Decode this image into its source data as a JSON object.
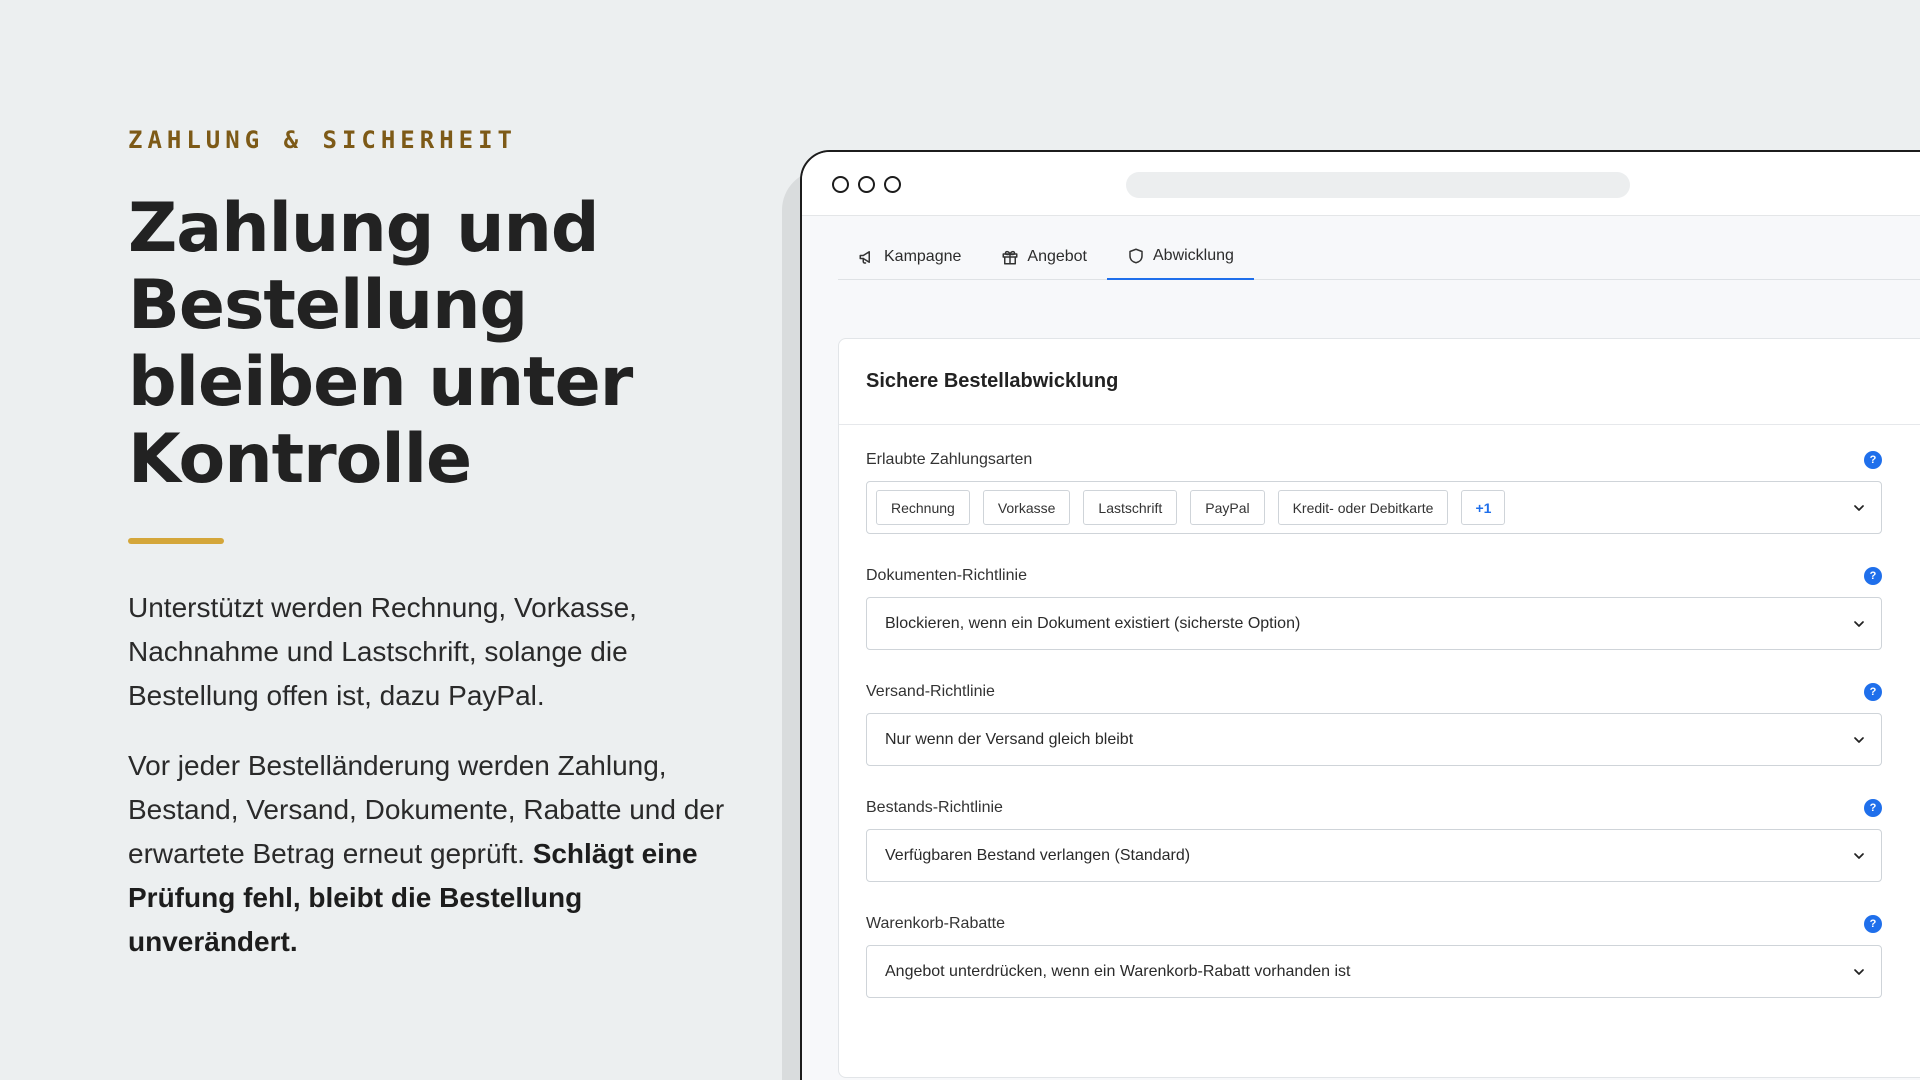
{
  "hero": {
    "eyebrow": "ZAHLUNG & SICHERHEIT",
    "headline": "Zahlung und Bestellung bleiben unter Kontrolle",
    "paragraph1": "Unterstützt werden Rechnung, Vorkasse, Nachnahme und Lastschrift, solange die Bestellung offen ist, dazu PayPal.",
    "paragraph2": "Vor jeder Bestelländerung werden Zahlung, Bestand, Versand, Dokumente, Rabatte und der erwartete Betrag erneut geprüft.",
    "paragraph2_bold": "Schlägt eine Prüfung fehl, bleibt die Bestellung unverändert."
  },
  "tabs": [
    {
      "label": "Kampagne",
      "icon": "megaphone-icon"
    },
    {
      "label": "Angebot",
      "icon": "gift-icon"
    },
    {
      "label": "Abwicklung",
      "icon": "shield-icon",
      "active": true
    }
  ],
  "panel": {
    "title": "Sichere Bestellabwicklung",
    "payment_methods": {
      "label": "Erlaubte Zahlungsarten",
      "chips": [
        "Rechnung",
        "Vorkasse",
        "Lastschrift",
        "PayPal",
        "Kredit- oder Debitkarte"
      ],
      "more": "+1"
    },
    "document_policy": {
      "label": "Dokumenten-Richtlinie",
      "value": "Blockieren, wenn ein Dokument existiert (sicherste Option)"
    },
    "shipping_policy": {
      "label": "Versand-Richtlinie",
      "value": "Nur wenn der Versand gleich bleibt"
    },
    "stock_policy": {
      "label": "Bestands-Richtlinie",
      "value": "Verfügbaren Bestand verlangen (Standard)"
    },
    "cart_discounts": {
      "label": "Warenkorb-Rabatte",
      "value": "Angebot unterdrücken, wenn ein Warenkorb-Rabatt vorhanden ist"
    },
    "help_glyph": "?"
  },
  "colors": {
    "accent": "#1f6feb",
    "eyebrow": "#7d5a17",
    "bar": "#d4a63a"
  }
}
